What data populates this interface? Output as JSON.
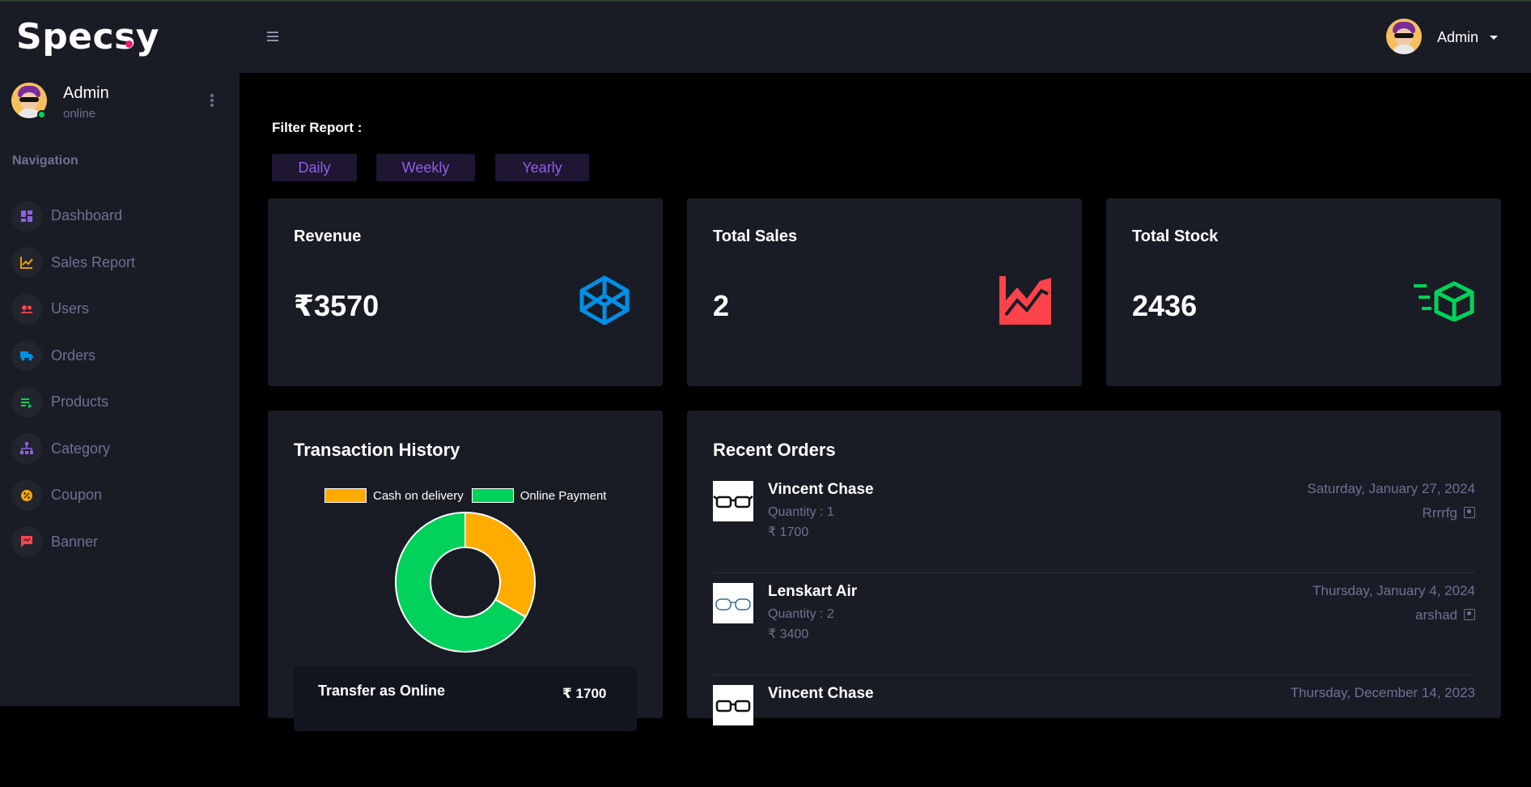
{
  "brand": "Specsy",
  "profile": {
    "name": "Admin",
    "status": "online"
  },
  "nav": {
    "heading": "Navigation",
    "items": [
      {
        "label": "Dashboard",
        "icon": "dashboard-icon",
        "color": "#8f5fe8"
      },
      {
        "label": "Sales Report",
        "icon": "chart-line-icon",
        "color": "#ffab00"
      },
      {
        "label": "Users",
        "icon": "users-icon",
        "color": "#fc424a"
      },
      {
        "label": "Orders",
        "icon": "truck-icon",
        "color": "#0090e7"
      },
      {
        "label": "Products",
        "icon": "playlist-icon",
        "color": "#00d25b"
      },
      {
        "label": "Category",
        "icon": "sitemap-icon",
        "color": "#8f5fe8"
      },
      {
        "label": "Coupon",
        "icon": "coupon-icon",
        "color": "#ffab00"
      },
      {
        "label": "Banner",
        "icon": "message-icon",
        "color": "#fc424a"
      }
    ]
  },
  "topbar": {
    "user": "Admin"
  },
  "filter": {
    "label": "Filter Report :",
    "buttons": [
      "Daily",
      "Weekly",
      "Yearly"
    ]
  },
  "stats": [
    {
      "title": "Revenue",
      "value": "₹3570",
      "icon": "codepen-icon",
      "color": "#0090e7"
    },
    {
      "title": "Total Sales",
      "value": "2",
      "icon": "chart-areaspline-icon",
      "color": "#fc424a"
    },
    {
      "title": "Total Stock",
      "value": "2436",
      "icon": "cube-send-icon",
      "color": "#00d25b"
    }
  ],
  "transactions": {
    "title": "Transaction History",
    "legend": [
      "Cash on delivery",
      "Online Payment"
    ],
    "transfer_title": "Transfer as Online",
    "transfer_amount": "₹ 1700"
  },
  "chart_data": {
    "type": "pie",
    "categories": [
      "Cash on delivery",
      "Online Payment"
    ],
    "values": [
      1,
      2
    ],
    "colors": [
      "#ffab00",
      "#00d25b"
    ]
  },
  "recent_orders": {
    "title": "Recent Orders",
    "items": [
      {
        "name": "Vincent Chase",
        "quantity": "Quantity : 1",
        "price": "₹ 1700",
        "date": "Saturday, January 27, 2024",
        "user": "Rrrrfg"
      },
      {
        "name": "Lenskart Air",
        "quantity": "Quantity : 2",
        "price": "₹ 3400",
        "date": "Thursday, January 4, 2024",
        "user": "arshad"
      },
      {
        "name": "Vincent Chase",
        "quantity": "",
        "price": "",
        "date": "Thursday, December 14, 2023",
        "user": ""
      }
    ]
  }
}
